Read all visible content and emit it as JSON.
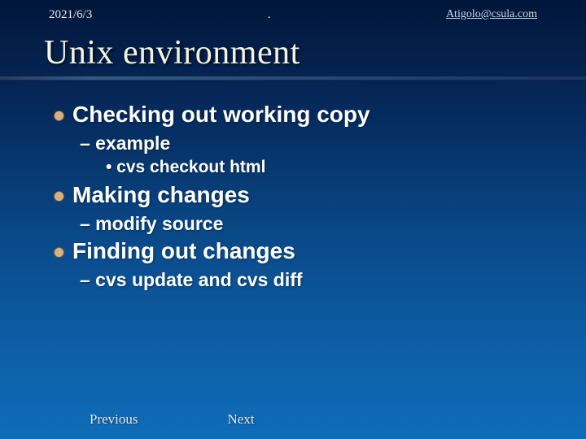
{
  "header": {
    "date": "2021/6/3",
    "center": ".",
    "email": "Atigolo@csula.com"
  },
  "title": "Unix environment",
  "bullets": [
    {
      "text": "Checking out working copy",
      "sub": [
        {
          "text": "– example",
          "sub": [
            {
              "text": "• cvs checkout html"
            }
          ]
        }
      ]
    },
    {
      "text": "Making changes",
      "sub": [
        {
          "text": "– modify source"
        }
      ]
    },
    {
      "text": "Finding out changes",
      "sub": [
        {
          "text": "– cvs update and cvs diff"
        }
      ]
    }
  ],
  "footer": {
    "prev": "Previous",
    "next": "Next"
  }
}
